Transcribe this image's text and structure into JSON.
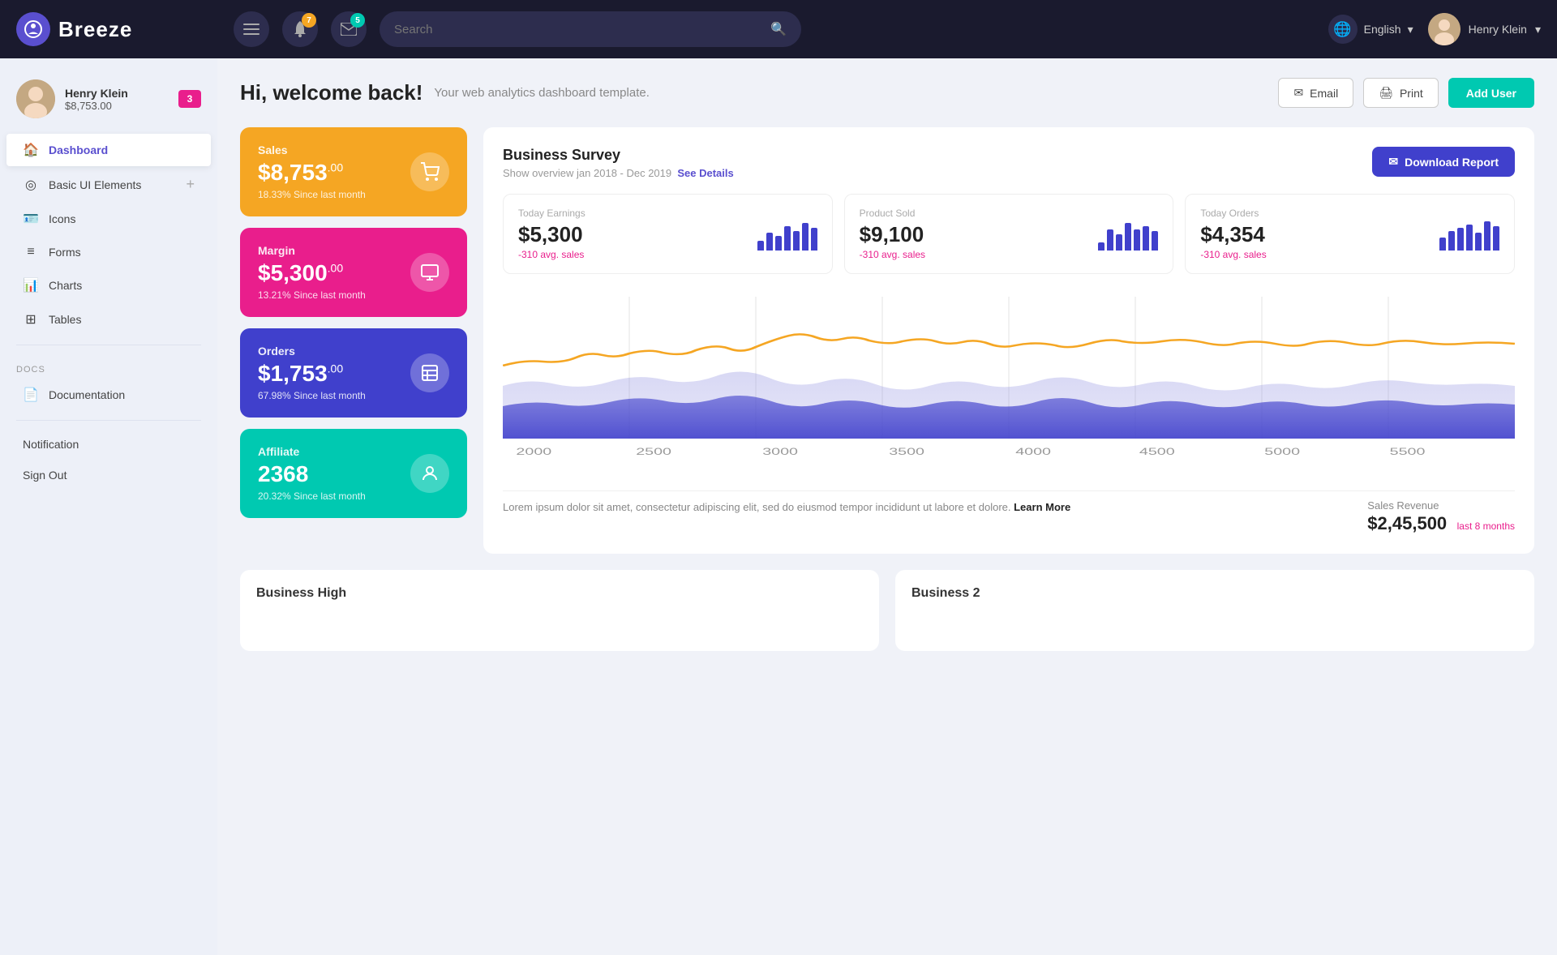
{
  "topbar": {
    "logo_text": "Breeze",
    "notifications_count": "7",
    "messages_count": "5",
    "search_placeholder": "Search",
    "language": "English",
    "user_name": "Henry Klein"
  },
  "sidebar": {
    "user_name": "Henry Klein",
    "user_money": "$8,753.00",
    "user_badge": "3",
    "nav_items": [
      {
        "label": "Dashboard",
        "icon": "🏠",
        "active": true
      },
      {
        "label": "Basic UI Elements",
        "icon": "◎",
        "has_plus": true
      },
      {
        "label": "Icons",
        "icon": "🪪"
      },
      {
        "label": "Forms",
        "icon": "≡"
      },
      {
        "label": "Charts",
        "icon": "📊"
      },
      {
        "label": "Tables",
        "icon": "⊞"
      }
    ],
    "section_docs": "Docs",
    "documentation": "Documentation",
    "notification": "Notification",
    "sign_out": "Sign Out"
  },
  "welcome": {
    "title": "Hi, welcome back!",
    "subtitle": "Your web analytics dashboard template.",
    "email_btn": "Email",
    "print_btn": "Print",
    "add_user_btn": "Add User"
  },
  "stat_cards": [
    {
      "label": "Sales",
      "value": "$8,753",
      "decimal": ".00",
      "change": "18.33% Since last month",
      "color": "orange",
      "icon": "🛒"
    },
    {
      "label": "Margin",
      "value": "$5,300",
      "decimal": ".00",
      "change": "13.21% Since last month",
      "color": "pink",
      "icon": "📦"
    },
    {
      "label": "Orders",
      "value": "$1,753",
      "decimal": ".00",
      "change": "67.98% Since last month",
      "color": "blue",
      "icon": "🗂️"
    },
    {
      "label": "Affiliate",
      "value": "2368",
      "decimal": "",
      "change": "20.32% Since last month",
      "color": "teal",
      "icon": "👤"
    }
  ],
  "survey": {
    "title": "Business Survey",
    "subtitle": "Show overview jan 2018 - Dec 2019",
    "see_details": "See Details",
    "download_btn": "Download Report"
  },
  "mini_stats": [
    {
      "label": "Today Earnings",
      "value": "$5,300",
      "change": "-310 avg. sales",
      "bars": [
        30,
        50,
        40,
        70,
        55,
        80,
        65
      ]
    },
    {
      "label": "Product Sold",
      "value": "$9,100",
      "change": "-310 avg. sales",
      "bars": [
        25,
        60,
        45,
        80,
        60,
        70,
        55
      ]
    },
    {
      "label": "Today Orders",
      "value": "$4,354",
      "change": "-310 avg. sales",
      "bars": [
        40,
        55,
        65,
        75,
        50,
        85,
        70
      ]
    }
  ],
  "chart": {
    "x_labels": [
      "2000",
      "2500",
      "3000",
      "3500",
      "4000",
      "4500",
      "5000",
      "5500"
    ],
    "footer_text": "Lorem ipsum dolor sit amet, consectetur adipiscing elit, sed do eiusmod tempor incididunt ut labore et dolore.",
    "learn_more": "Learn More",
    "sales_label": "Sales Revenue",
    "sales_value": "$2,45,500",
    "sales_period": "last 8 months"
  },
  "bottom": {
    "left_title": "Business High",
    "right_title": "Business 2"
  }
}
